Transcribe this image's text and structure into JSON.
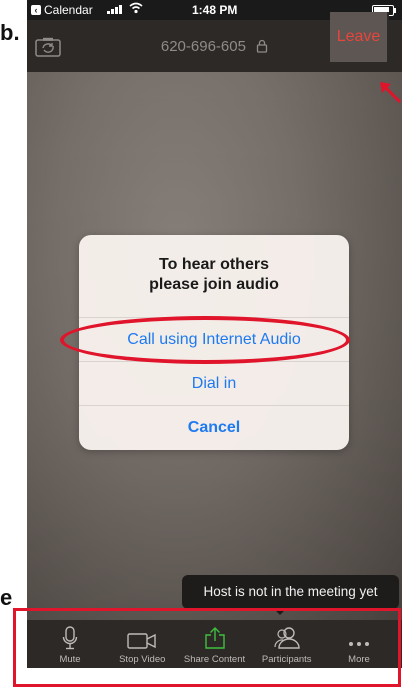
{
  "tutorial": {
    "step_letter_top": "b.",
    "step_letter_bottom": "e"
  },
  "status_bar": {
    "back_app": "Calendar",
    "time": "1:48 PM",
    "battery_level": 0.95
  },
  "meeting_bar": {
    "meeting_id": "620-696-605",
    "leave_label": "Leave"
  },
  "dialog": {
    "title_line1": "To hear others",
    "title_line2": "please join audio",
    "btn_internet": "Call using Internet Audio",
    "btn_dial": "Dial in",
    "btn_cancel": "Cancel"
  },
  "toast": {
    "text": "Host is not in the meeting yet"
  },
  "toolbar": {
    "items": [
      {
        "label": "Mute",
        "icon": "microphone-icon"
      },
      {
        "label": "Stop Video",
        "icon": "video-camera-icon"
      },
      {
        "label": "Share Content",
        "icon": "share-icon"
      },
      {
        "label": "Participants",
        "icon": "participants-icon"
      },
      {
        "label": "More",
        "icon": "more-icon"
      }
    ]
  },
  "colors": {
    "accent_blue": "#1e7af0",
    "leave_red": "#e8453c",
    "annotation_red": "#e0142a",
    "share_green": "#3fbf3f",
    "bar_dark": "#2d2926"
  }
}
